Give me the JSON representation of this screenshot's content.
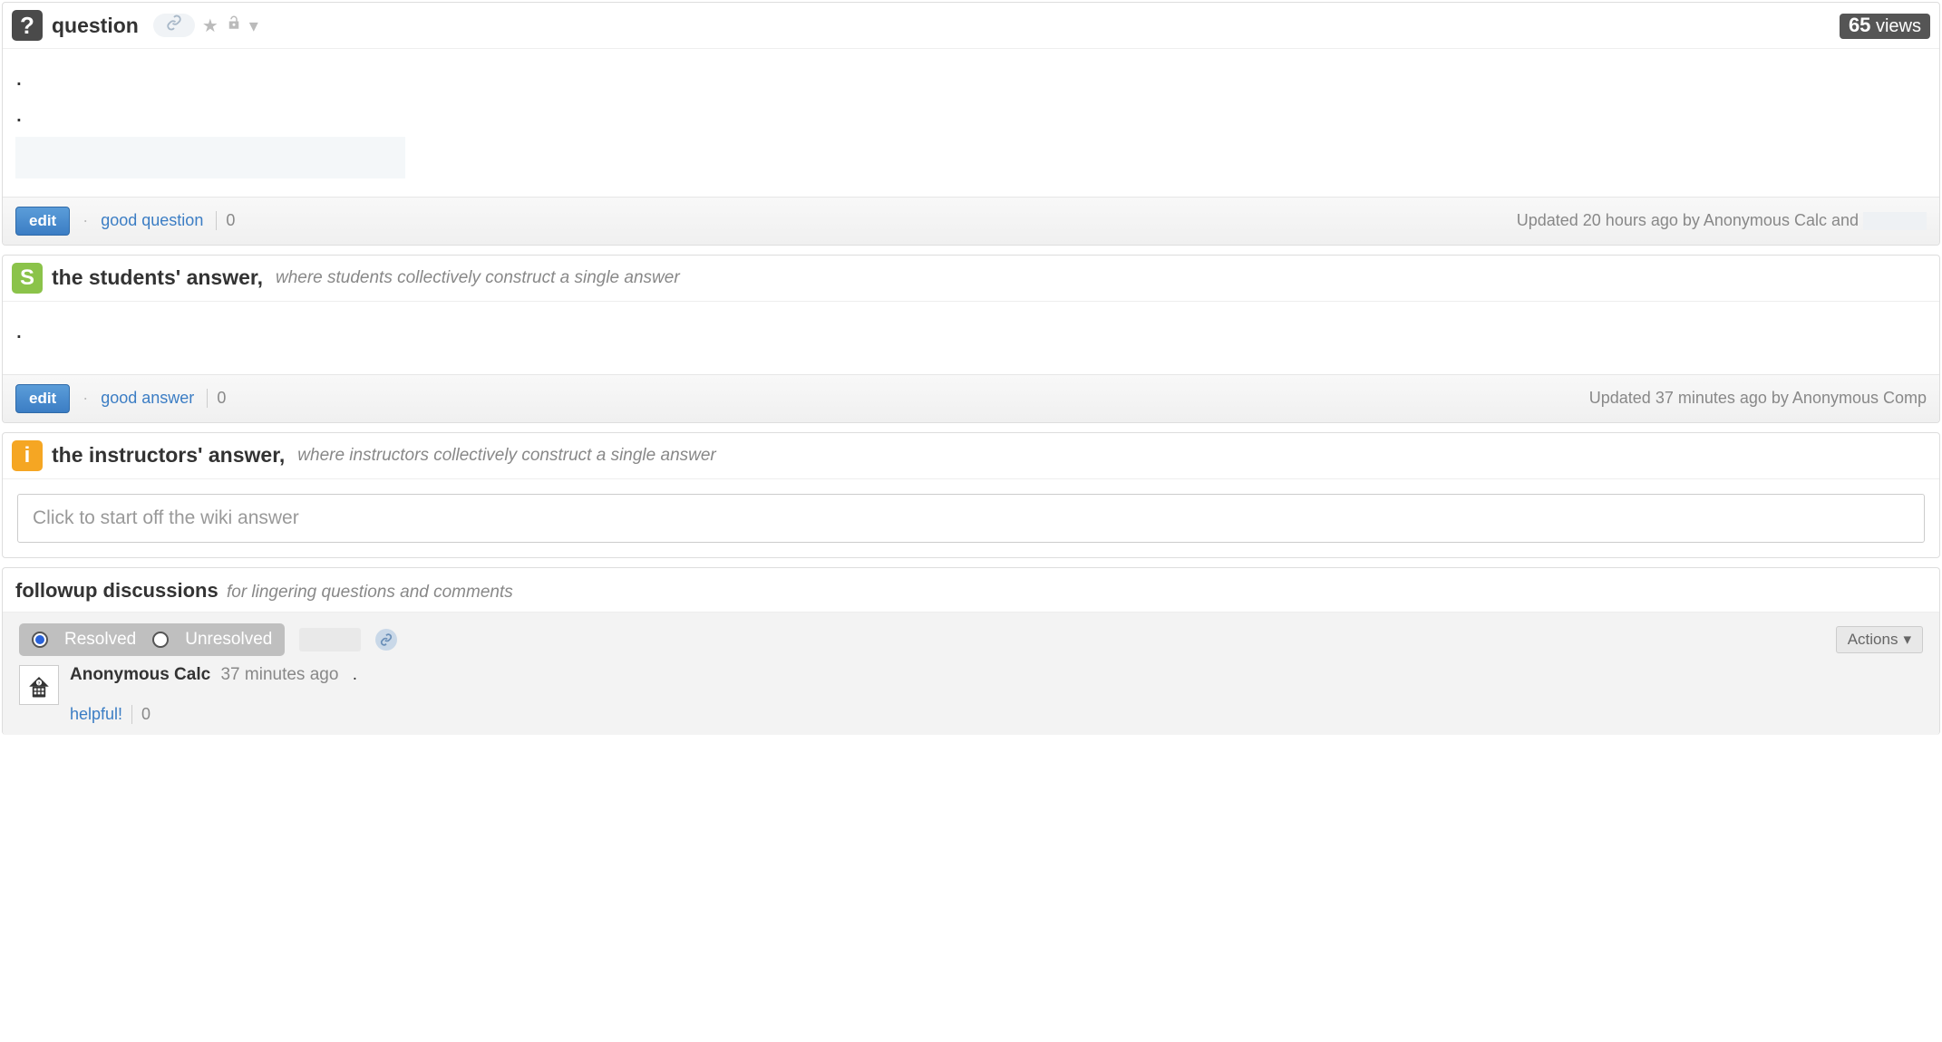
{
  "question": {
    "label": "question",
    "views_count": "65",
    "views_label": "views",
    "body_dots": [
      ".",
      "."
    ],
    "footer": {
      "edit": "edit",
      "good": "good question",
      "count": "0",
      "updated": "Updated 20 hours ago by Anonymous Calc and "
    }
  },
  "students_answer": {
    "title": "the students' answer,",
    "subtitle": "where students collectively construct a single answer",
    "body_dot": ".",
    "footer": {
      "edit": "edit",
      "good": "good answer",
      "count": "0",
      "updated": "Updated 37 minutes ago by Anonymous Comp"
    }
  },
  "instructors_answer": {
    "title": "the instructors' answer,",
    "subtitle": "where instructors collectively construct a single answer",
    "placeholder": "Click to start off the wiki answer"
  },
  "followup": {
    "title": "followup discussions",
    "subtitle": "for lingering questions and comments",
    "resolved": "Resolved",
    "unresolved": "Unresolved",
    "actions": "Actions",
    "comment": {
      "author": "Anonymous Calc",
      "time": "37 minutes ago",
      "trailing": ".",
      "helpful": "helpful!",
      "count": "0"
    }
  }
}
